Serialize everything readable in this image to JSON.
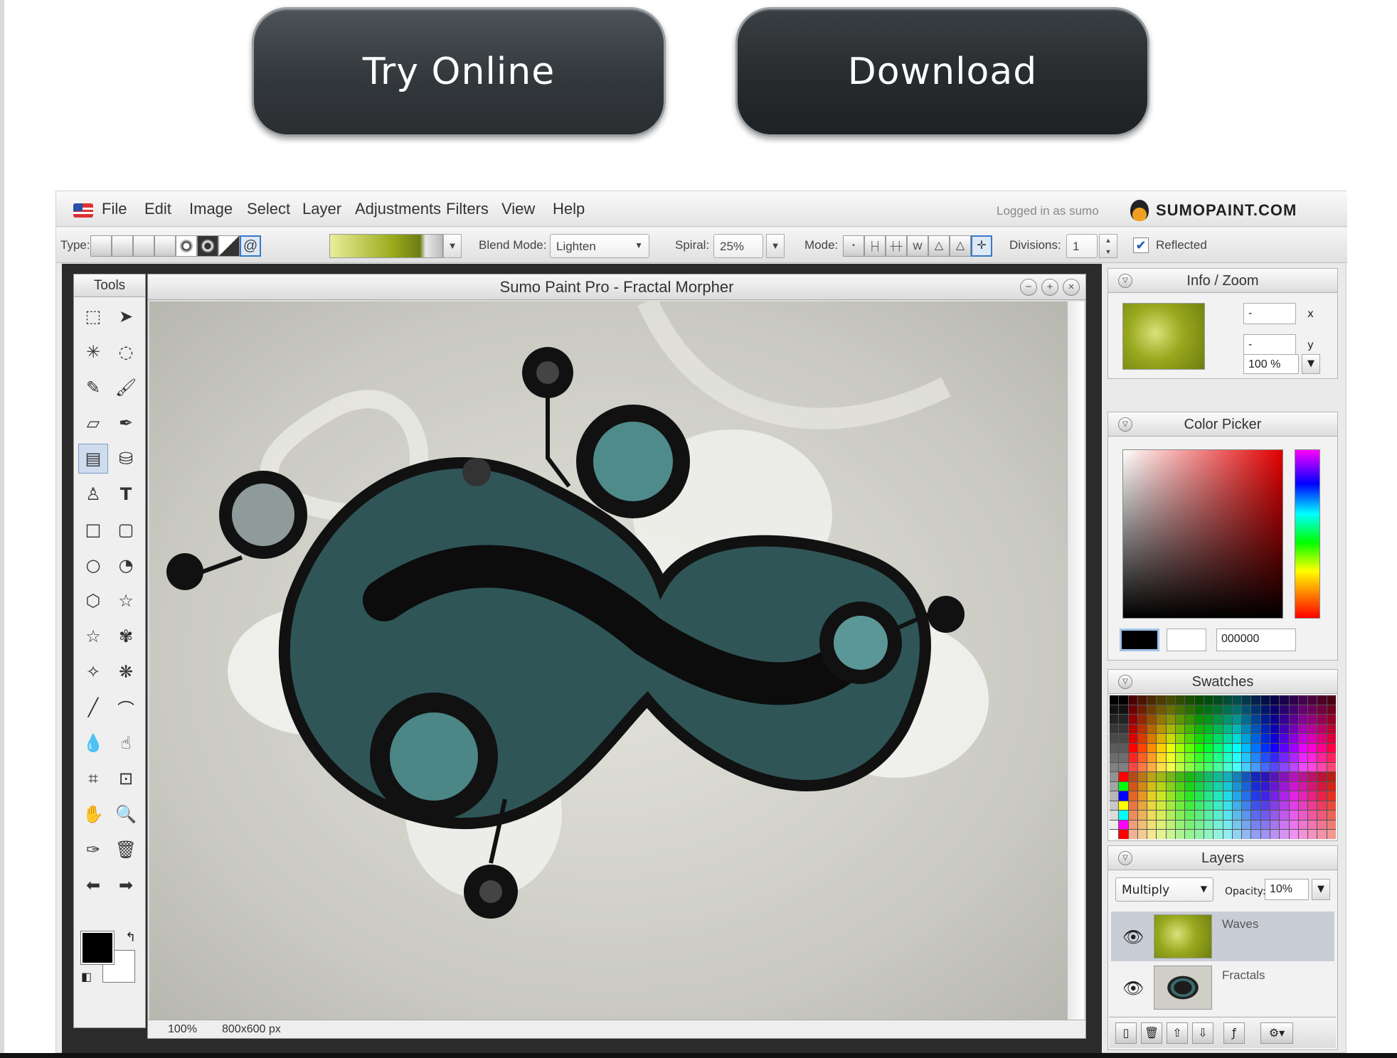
{
  "cta": {
    "try_label": "Try Online",
    "download_label": "Download"
  },
  "menubar": {
    "items": [
      "File",
      "Edit",
      "Image",
      "Select",
      "Layer",
      "Adjustments",
      "Filters",
      "View",
      "Help"
    ],
    "logged_in": "Logged in as sumo",
    "logo": "SUMOPAINT.COM"
  },
  "options": {
    "type_label": "Type:",
    "blend_label": "Blend Mode:",
    "blend_value": "Lighten",
    "spiral_label": "Spiral:",
    "spiral_value": "25%",
    "mode_label": "Mode:",
    "divisions_label": "Divisions:",
    "divisions_value": "1",
    "reflected_label": "Reflected",
    "reflected_checked": true
  },
  "tools": {
    "title": "Tools",
    "active": "gradient-tool"
  },
  "document": {
    "title": "Sumo Paint Pro - Fractal Morpher",
    "zoom": "100%",
    "size": "800x600 px"
  },
  "info_zoom": {
    "title": "Info / Zoom",
    "x_value": "-",
    "y_value": "-",
    "x_label": "x",
    "y_label": "y",
    "zoom": "100 %"
  },
  "color_picker": {
    "title": "Color Picker",
    "hex": "000000",
    "primary": "#000000",
    "secondary": "#ffffff"
  },
  "swatches": {
    "title": "Swatches"
  },
  "layers": {
    "title": "Layers",
    "blend": "Multiply",
    "opacity_label": "Opacity:",
    "opacity": "10%",
    "items": [
      {
        "name": "Waves",
        "selected": true
      },
      {
        "name": "Fractals",
        "selected": false
      }
    ]
  }
}
